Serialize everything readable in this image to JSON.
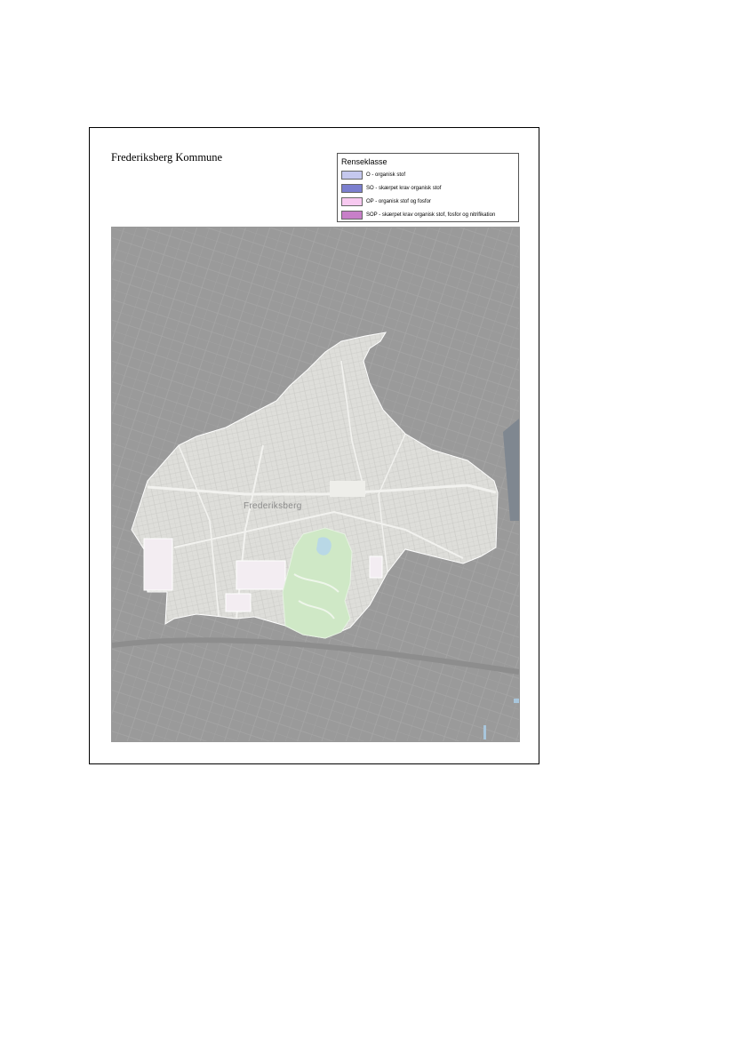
{
  "map": {
    "title": "Frederiksberg Kommune",
    "place_label": "Frederiksberg",
    "legend": {
      "title": "Renseklasse",
      "items": [
        {
          "label": "O - organisk stof",
          "color": "#c5c8ee"
        },
        {
          "label": "SO - skærpet krav organisk stof",
          "color": "#7b7fcf"
        },
        {
          "label": "OP - organisk stof og fosfor",
          "color": "#f7c9f0"
        },
        {
          "label": "SOP - skærpet krav organisk stof, fosfor og nitrifikation",
          "color": "#c77fc8"
        }
      ]
    },
    "colors": {
      "background": "#9a9a9a",
      "municipality": "#dededa",
      "park": "#cfe8c6",
      "roads": "#f2f2ef",
      "open_area": "#f3edf2"
    }
  }
}
